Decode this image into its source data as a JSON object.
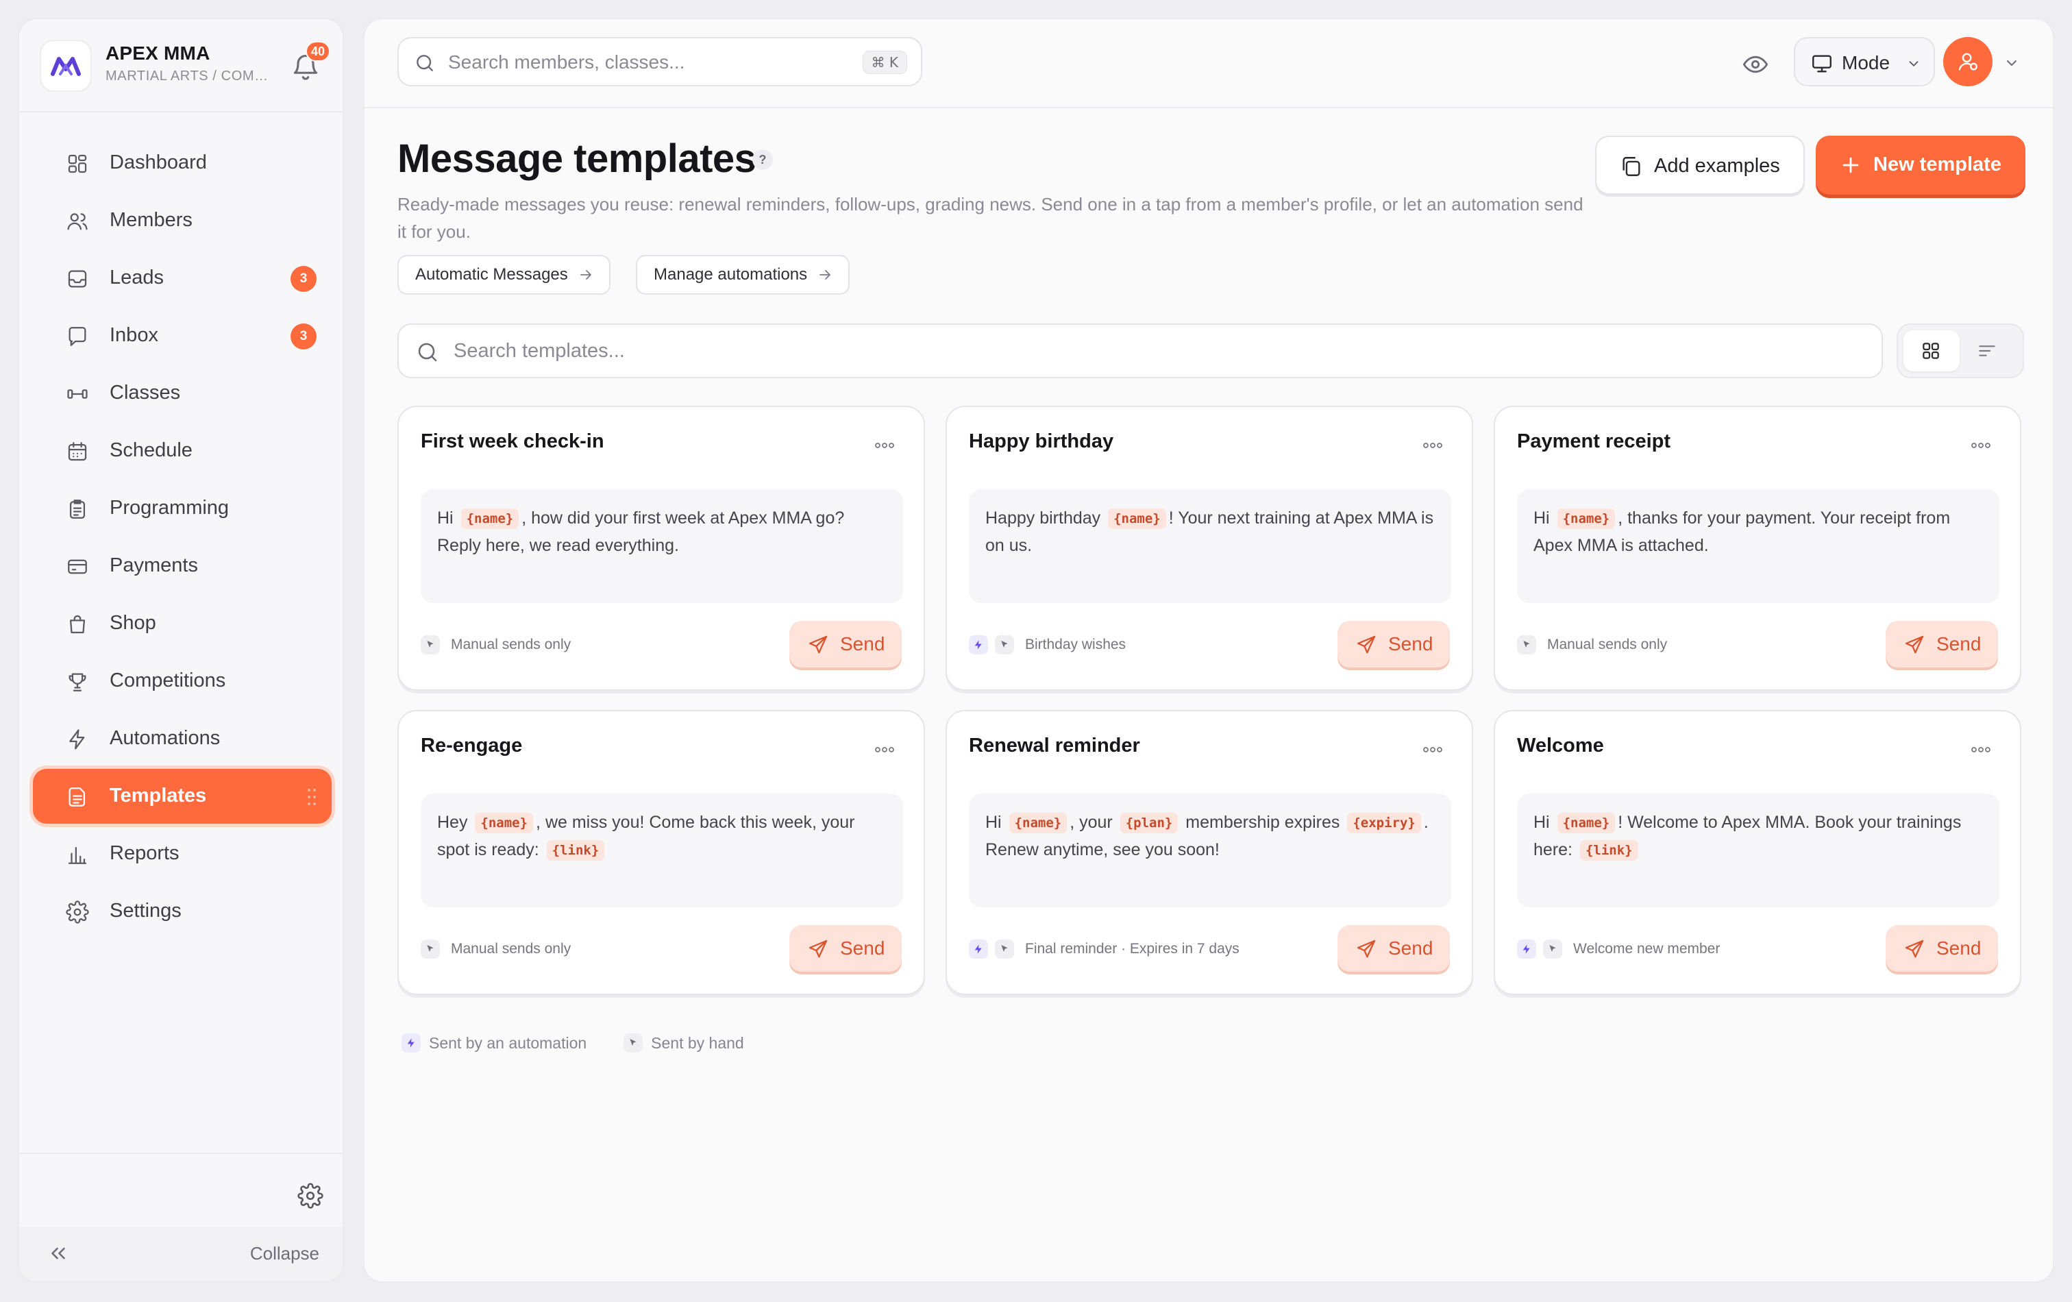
{
  "brand": {
    "name": "APEX MMA",
    "subtitle": "MARTIAL ARTS / COMBAT",
    "notifications": "40"
  },
  "nav": [
    {
      "label": "Dashboard",
      "icon": "dashboard-icon"
    },
    {
      "label": "Members",
      "icon": "members-icon"
    },
    {
      "label": "Leads",
      "icon": "inbox-tray-icon",
      "badge": "3"
    },
    {
      "label": "Inbox",
      "icon": "chat-bubble-icon",
      "badge": "3"
    },
    {
      "label": "Classes",
      "icon": "dumbbell-icon"
    },
    {
      "label": "Schedule",
      "icon": "calendar-icon"
    },
    {
      "label": "Programming",
      "icon": "clipboard-icon"
    },
    {
      "label": "Payments",
      "icon": "credit-card-icon"
    },
    {
      "label": "Shop",
      "icon": "shopping-bag-icon"
    },
    {
      "label": "Competitions",
      "icon": "trophy-icon"
    },
    {
      "label": "Automations",
      "icon": "lightning-icon"
    },
    {
      "label": "Templates",
      "icon": "document-icon",
      "active": true
    },
    {
      "label": "Reports",
      "icon": "bar-chart-icon"
    },
    {
      "label": "Settings",
      "icon": "gear-icon"
    }
  ],
  "sidebar_footer": {
    "collapse_label": "Collapse"
  },
  "topbar": {
    "search_placeholder": "Search members, classes...",
    "shortcut": "⌘ K",
    "mode_label": "Mode"
  },
  "page": {
    "title": "Message templates",
    "help": "?",
    "subtitle": "Ready-made messages you reuse: renewal reminders, follow-ups, grading news. Send one in a tap from a member's profile, or let an automation send it for you.",
    "chip_automatic": "Automatic Messages",
    "chip_manage": "Manage automations",
    "add_examples_label": "Add examples",
    "new_template_label": "New template",
    "template_search_placeholder": "Search templates..."
  },
  "cards": [
    {
      "title": "First week check-in",
      "body": [
        [
          "t",
          "Hi "
        ],
        [
          "v",
          "{name}"
        ],
        [
          "t",
          ", how did your first week at Apex MMA go? Reply here, we read everything."
        ]
      ],
      "auto": false,
      "footer": "Manual sends only",
      "send_label": "Send"
    },
    {
      "title": "Happy birthday",
      "body": [
        [
          "t",
          "Happy birthday "
        ],
        [
          "v",
          "{name}"
        ],
        [
          "t",
          "! Your next training at Apex MMA is on us."
        ]
      ],
      "auto": true,
      "footer": "Birthday wishes",
      "send_label": "Send"
    },
    {
      "title": "Payment receipt",
      "body": [
        [
          "t",
          "Hi "
        ],
        [
          "v",
          "{name}"
        ],
        [
          "t",
          ", thanks for your payment. Your receipt from Apex MMA is attached."
        ]
      ],
      "auto": false,
      "footer": "Manual sends only",
      "send_label": "Send"
    },
    {
      "title": "Re-engage",
      "body": [
        [
          "t",
          "Hey "
        ],
        [
          "v",
          "{name}"
        ],
        [
          "t",
          ", we miss you! Come back this week, your spot is ready: "
        ],
        [
          "v",
          "{link}"
        ]
      ],
      "auto": false,
      "footer": "Manual sends only",
      "send_label": "Send"
    },
    {
      "title": "Renewal reminder",
      "body": [
        [
          "t",
          "Hi "
        ],
        [
          "v",
          "{name}"
        ],
        [
          "t",
          ", your "
        ],
        [
          "v",
          "{plan}"
        ],
        [
          "t",
          " membership expires "
        ],
        [
          "v",
          "{expiry}"
        ],
        [
          "t",
          ". Renew anytime, see you soon!"
        ]
      ],
      "auto": true,
      "footer": "Final reminder · Expires in 7 days",
      "send_label": "Send"
    },
    {
      "title": "Welcome",
      "body": [
        [
          "t",
          "Hi "
        ],
        [
          "v",
          "{name}"
        ],
        [
          "t",
          "! Welcome to Apex MMA. Book your trainings here: "
        ],
        [
          "v",
          "{link}"
        ]
      ],
      "auto": true,
      "footer": "Welcome new member",
      "send_label": "Send"
    }
  ],
  "legend": {
    "auto_label": "Sent by an automation",
    "hand_label": "Sent by hand"
  },
  "colors": {
    "accent": "#ff6a3d",
    "accent_soft": "#fde3da",
    "automation": "#6b4de6"
  }
}
